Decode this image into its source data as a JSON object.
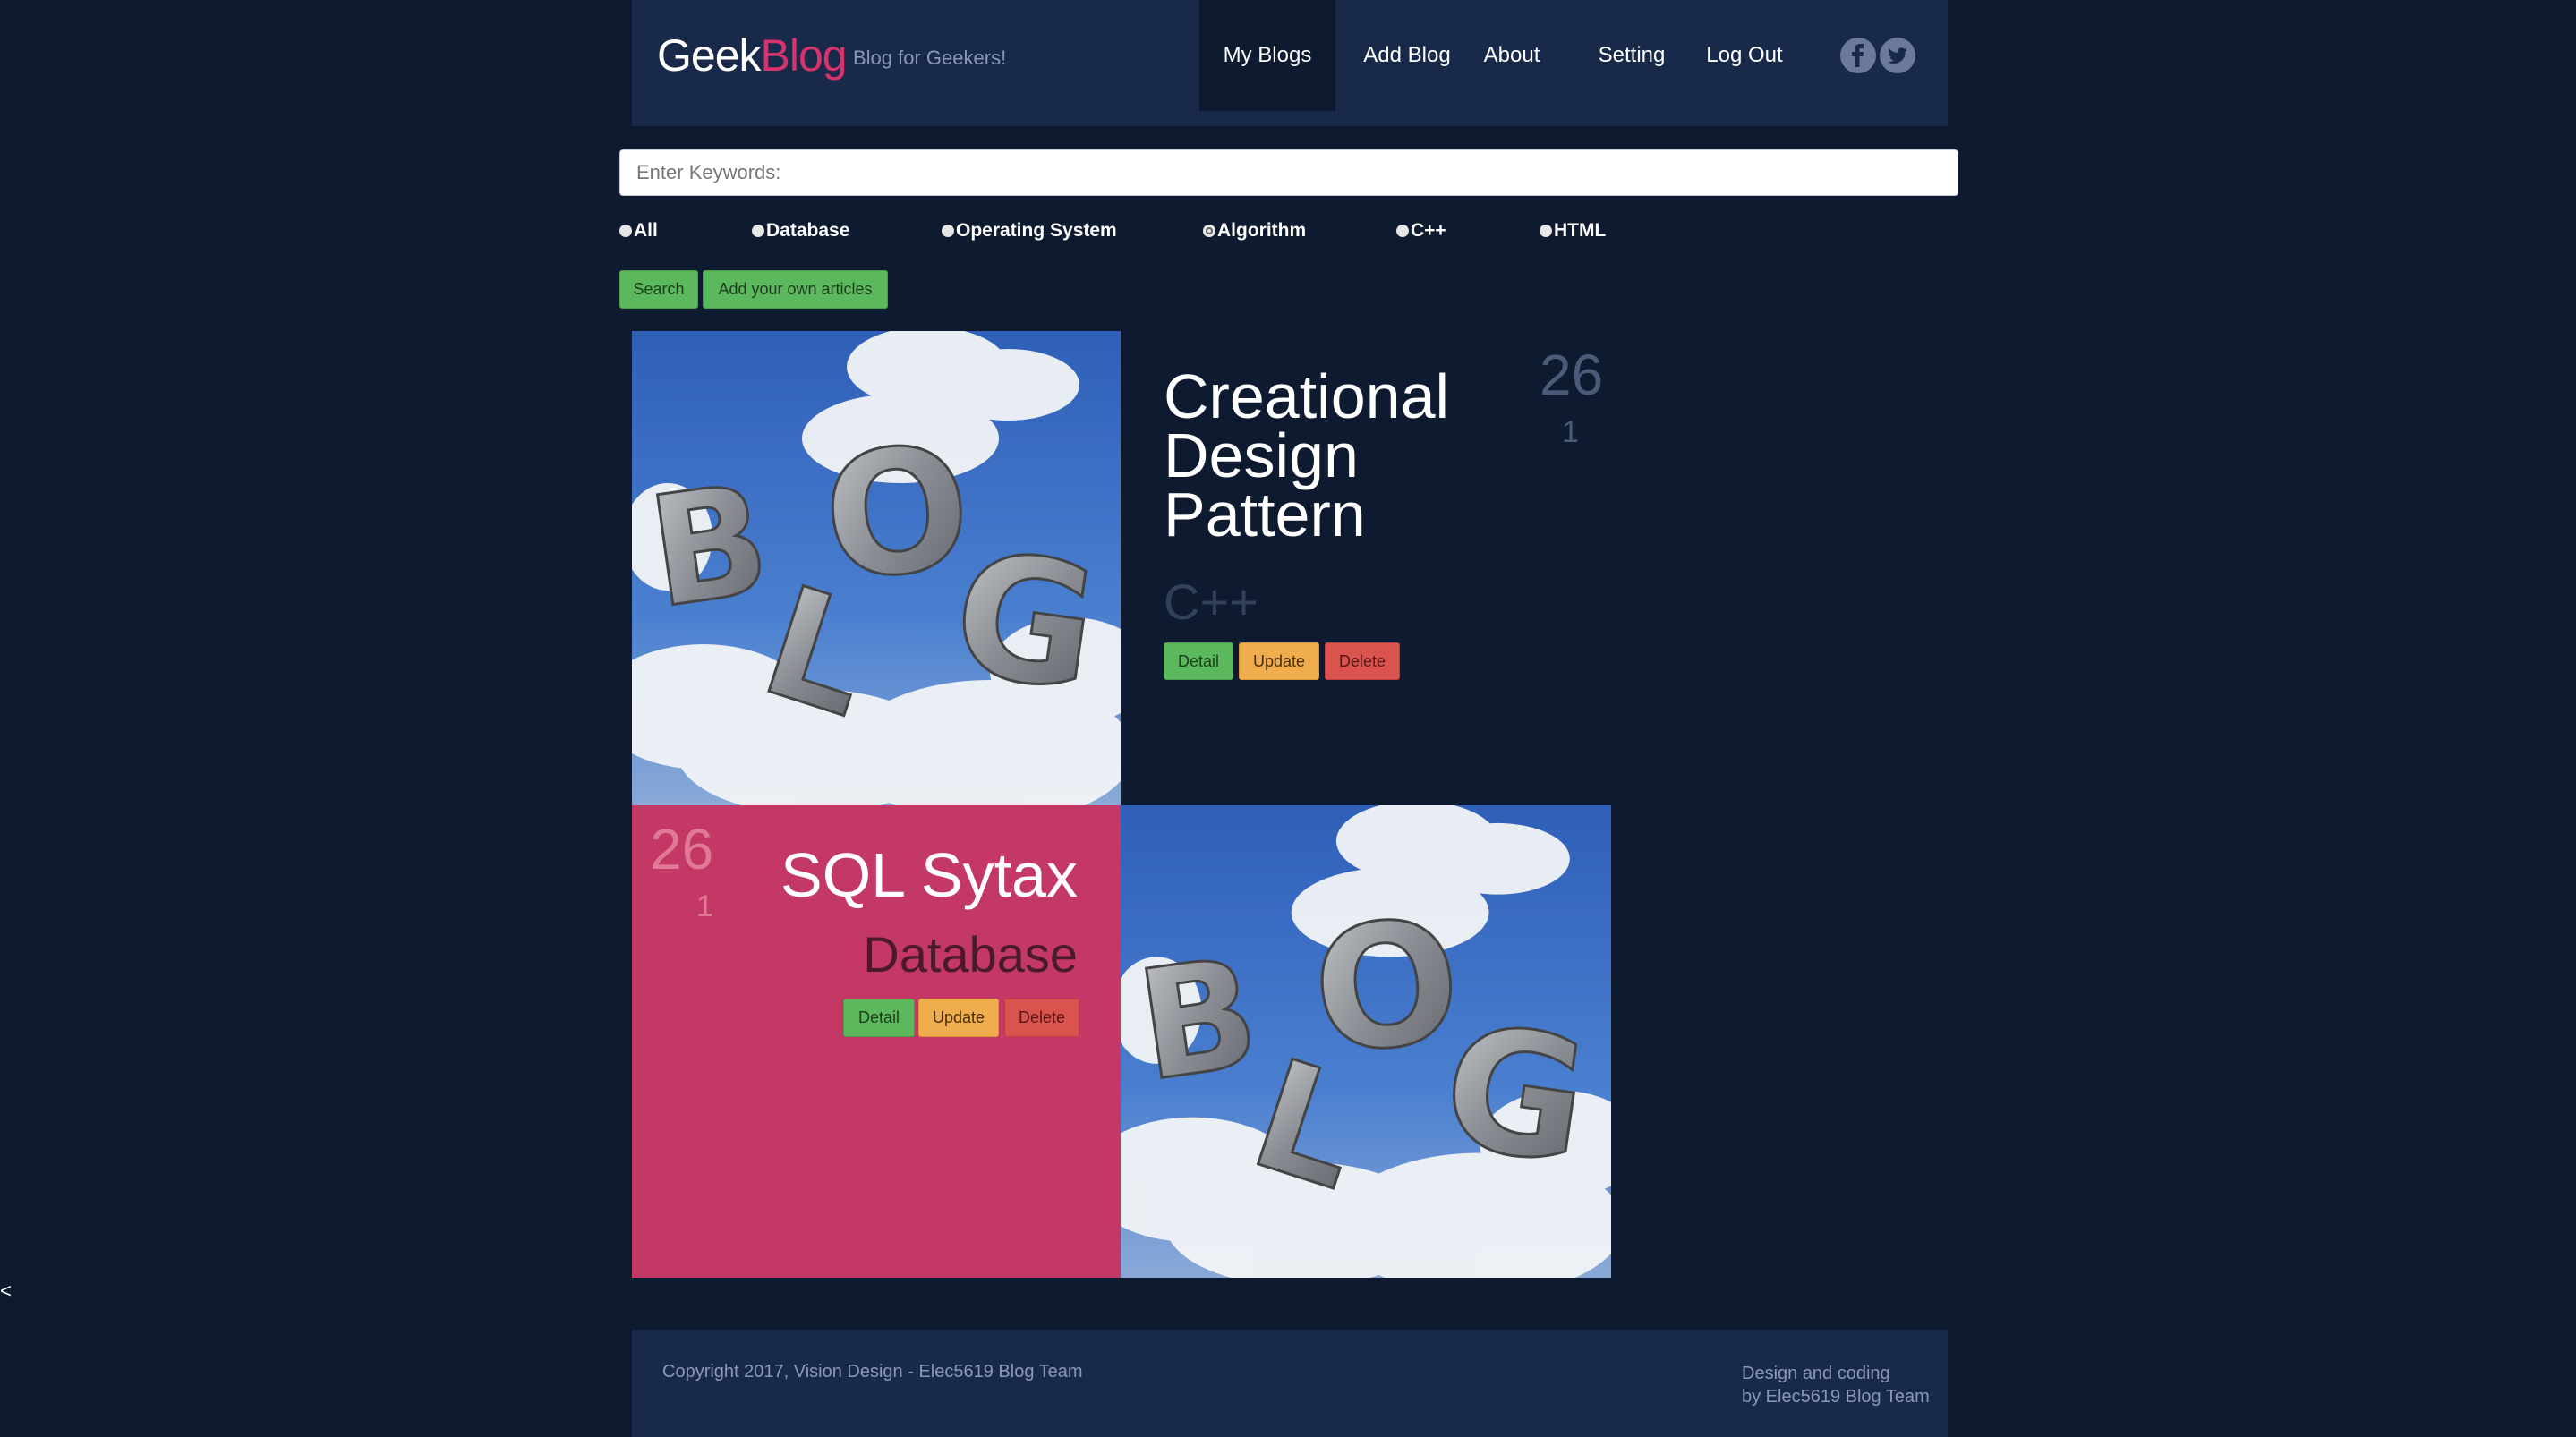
{
  "header": {
    "brand_geek": "Geek",
    "brand_blog": "Blog",
    "tagline": "Blog for Geekers!",
    "nav": {
      "my_blogs": "My Blogs",
      "add_blog": "Add Blog",
      "about": "About",
      "setting": "Setting",
      "log_out": "Log Out"
    },
    "social": {
      "facebook": "f",
      "twitter": "t"
    }
  },
  "search": {
    "placeholder": "Enter Keywords:",
    "filters": [
      "All",
      "Database",
      "Operating System",
      "Algorithm",
      "C++",
      "HTML"
    ],
    "search_label": "Search",
    "add_articles_label": "Add your own articles"
  },
  "cards": [
    {
      "title": "Creational Design Pattern",
      "category": "C++",
      "count": "26",
      "sub_count": "1",
      "detail_label": "Detail",
      "update_label": "Update",
      "delete_label": "Delete"
    },
    {
      "title": "SQL Sytax",
      "category": "Database",
      "count": "26",
      "sub_count": "1",
      "detail_label": "Detail",
      "update_label": "Update",
      "delete_label": "Delete"
    }
  ],
  "side_arrow": "<",
  "footer": {
    "left": "Copyright 2017, Vision Design - Elec5619 Blog Team",
    "right_line1": "Design and coding",
    "right_line2": "by Elec5619 Blog Team"
  },
  "colors": {
    "page_bg": "#0d1a30",
    "header_bg": "#19294a",
    "accent_pink": "#d6336c",
    "card_pink": "#c33865",
    "btn_green": "#5cb85c",
    "btn_orange": "#f0ad4e",
    "btn_red": "#d9534f"
  }
}
